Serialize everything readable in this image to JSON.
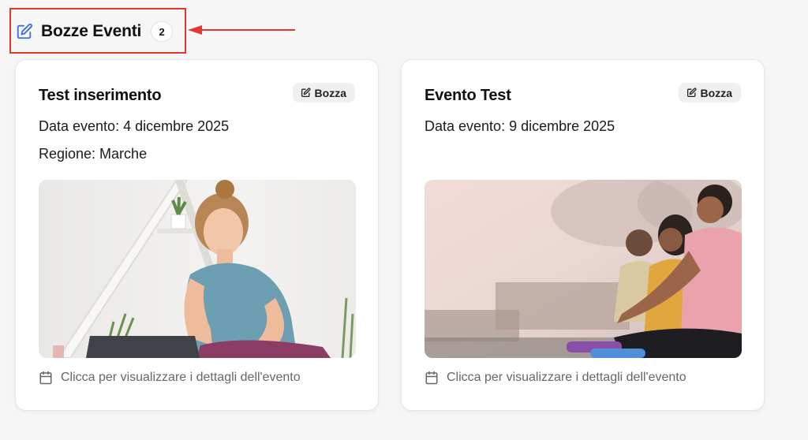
{
  "header": {
    "title": "Bozze Eventi",
    "count": "2",
    "icon": "edit-square-icon",
    "accent_color": "#3b6fe0",
    "highlight_color": "#e03a2f"
  },
  "cards": [
    {
      "title": "Test inserimento",
      "badge": "Bozza",
      "date_line": "Data evento: 4 dicembre 2025",
      "region_line": "Regione: Marche",
      "image": "woman-yoga-laptop-image",
      "footer": "Clicca per visualizzare i dettagli dell'evento"
    },
    {
      "title": "Evento Test",
      "badge": "Bozza",
      "date_line": "Data evento: 9 dicembre 2025",
      "region_line": "",
      "image": "group-meditation-image",
      "footer": "Clicca per visualizzare i dettagli dell'evento"
    }
  ]
}
